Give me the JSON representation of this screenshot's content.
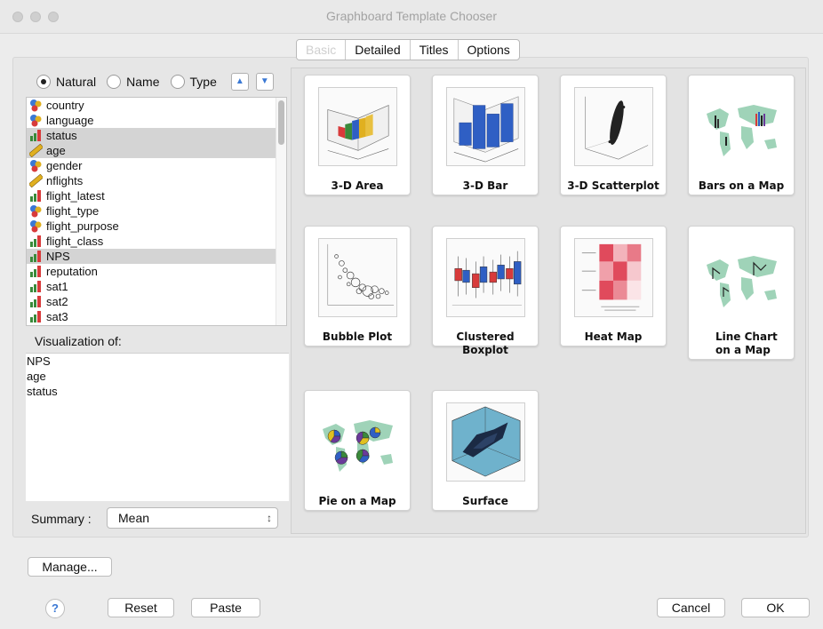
{
  "window": {
    "title": "Graphboard Template Chooser"
  },
  "tabs": [
    "Basic",
    "Detailed",
    "Titles",
    "Options"
  ],
  "sort": {
    "options": [
      "Natural",
      "Name",
      "Type"
    ],
    "selected": "Natural"
  },
  "variables": [
    {
      "name": "country",
      "type": "nominal",
      "selected": false
    },
    {
      "name": "language",
      "type": "nominal",
      "selected": false
    },
    {
      "name": "status",
      "type": "scale",
      "selected": true
    },
    {
      "name": "age",
      "type": "ruler",
      "selected": true
    },
    {
      "name": "gender",
      "type": "nominal",
      "selected": false
    },
    {
      "name": "nflights",
      "type": "ruler",
      "selected": false
    },
    {
      "name": "flight_latest",
      "type": "scale",
      "selected": false
    },
    {
      "name": "flight_type",
      "type": "nominal",
      "selected": false
    },
    {
      "name": "flight_purpose",
      "type": "nominal",
      "selected": false
    },
    {
      "name": "flight_class",
      "type": "scale",
      "selected": false
    },
    {
      "name": "NPS",
      "type": "scale",
      "selected": true
    },
    {
      "name": "reputation",
      "type": "scale",
      "selected": false
    },
    {
      "name": "sat1",
      "type": "scale",
      "selected": false
    },
    {
      "name": "sat2",
      "type": "scale",
      "selected": false
    },
    {
      "name": "sat3",
      "type": "scale",
      "selected": false
    }
  ],
  "visualization": {
    "label": "Visualization of:",
    "items": [
      "NPS",
      "age",
      "status"
    ]
  },
  "summary": {
    "label": "Summary :",
    "value": "Mean"
  },
  "templates": [
    {
      "label": "3-D Area",
      "icon": "3d-area-chart"
    },
    {
      "label": "3-D Bar",
      "icon": "3d-bar-chart"
    },
    {
      "label": "3-D Scatterplot",
      "icon": "3d-scatterplot"
    },
    {
      "label": "Bars on a Map",
      "icon": "bars-on-map"
    },
    {
      "label": "Bubble Plot",
      "icon": "bubble-plot"
    },
    {
      "label": "Clustered Boxplot",
      "icon": "clustered-boxplot"
    },
    {
      "label": "Heat Map",
      "icon": "heat-map"
    },
    {
      "label": "Line Chart on a Map",
      "icon": "line-chart-on-map"
    },
    {
      "label": "Pie on a Map",
      "icon": "pie-on-map"
    },
    {
      "label": "Surface",
      "icon": "surface-chart"
    }
  ],
  "buttons": {
    "manage": "Manage...",
    "reset": "Reset",
    "paste": "Paste",
    "cancel": "Cancel",
    "ok": "OK",
    "help": "?"
  },
  "colors": {
    "map_land": "#9fd3b8",
    "bar_blue": "#2f5fc4",
    "heat_red": "#e04a5c"
  }
}
